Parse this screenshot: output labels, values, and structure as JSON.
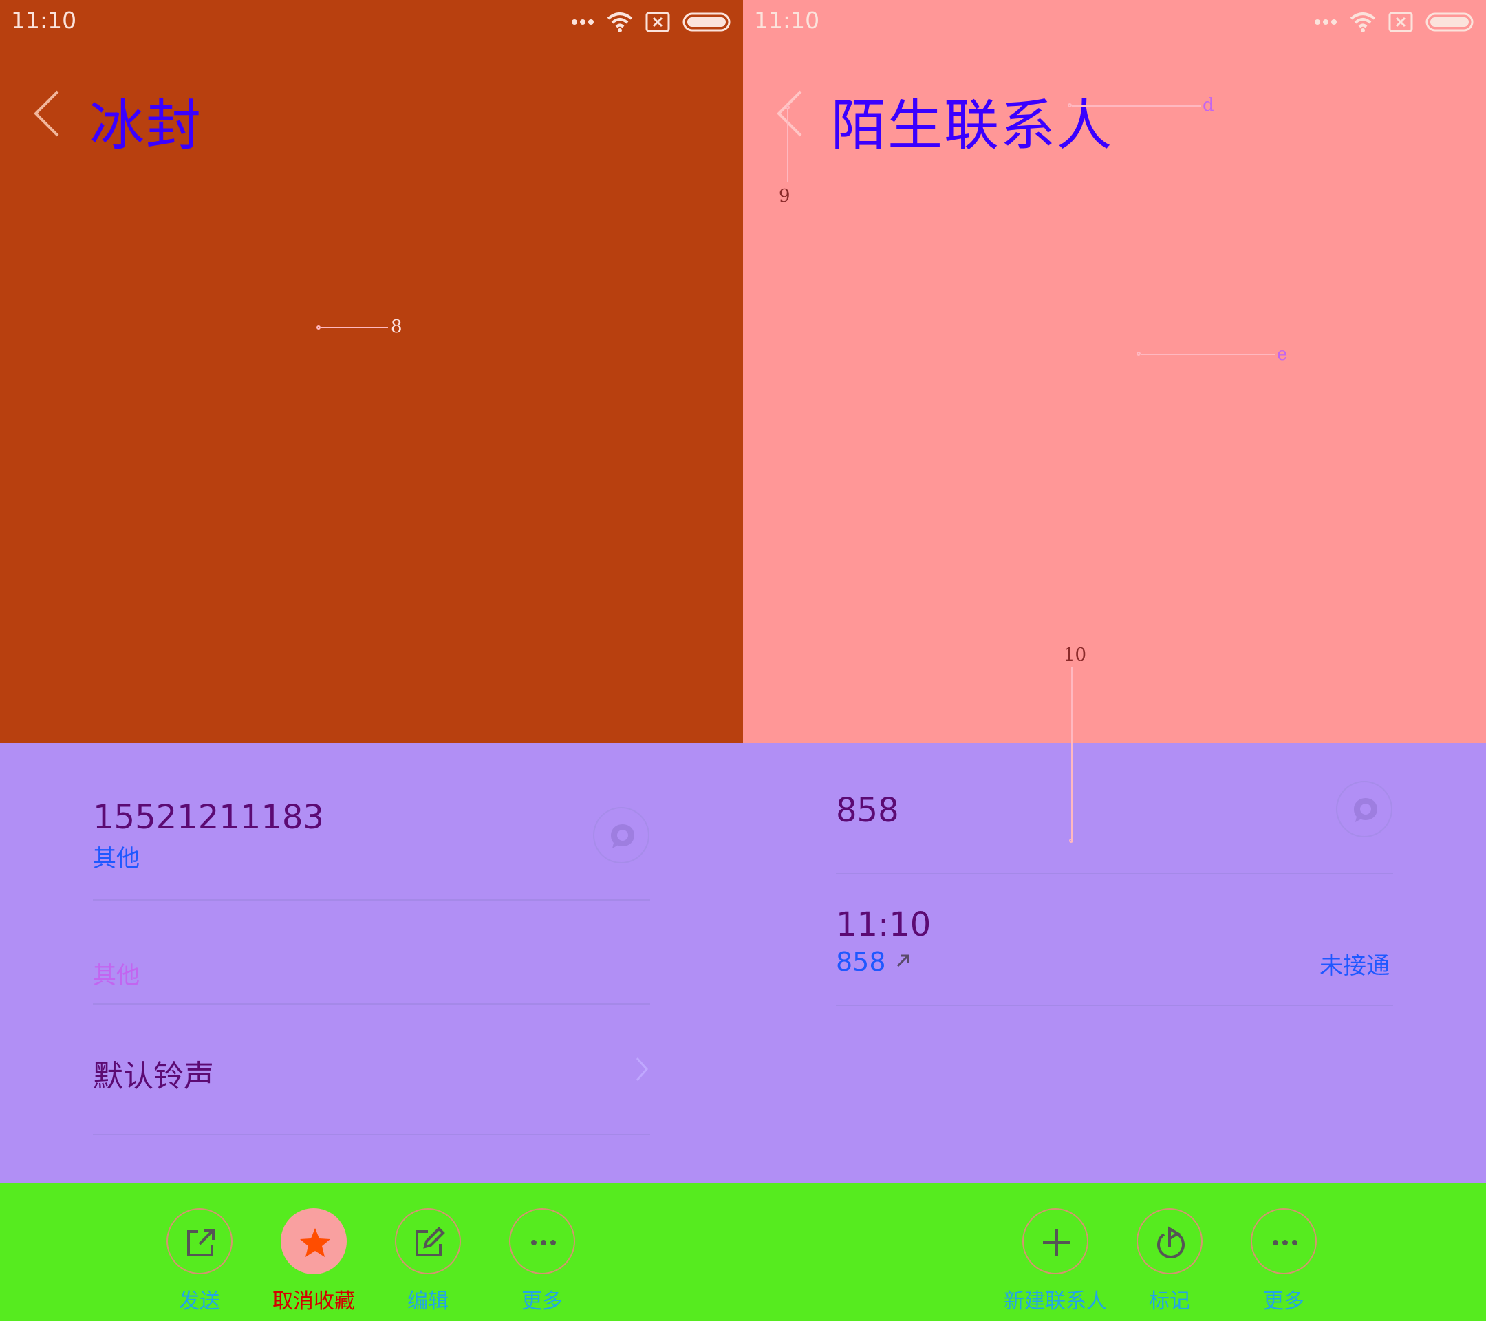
{
  "colors": {
    "left_header_bg": "#b8400f",
    "right_header_bg": "#ff9797",
    "content_bg": "#b18ff5",
    "toolbar_bg": "#56eb1f",
    "title_color": "#3a00ff",
    "primary_text": "#5c0a73",
    "secondary_text": "#1f58ff",
    "faded_label": "#c265f0",
    "toolbar_label": "#22a4e8",
    "favorite_active": "#d40000"
  },
  "left": {
    "status": {
      "time": "11:10"
    },
    "header": {
      "title": "冰封"
    },
    "annotations": {
      "a8": "8"
    },
    "phone": {
      "number": "15521211183",
      "type": "其他"
    },
    "group": {
      "label": "其他"
    },
    "ringtone": {
      "label": "默认铃声"
    },
    "toolbar": {
      "send": "发送",
      "unfavorite": "取消收藏",
      "edit": "编辑",
      "more": "更多"
    }
  },
  "right": {
    "status": {
      "time": "11:10"
    },
    "header": {
      "title": "陌生联系人"
    },
    "annotations": {
      "a9": "9",
      "ad": "d",
      "ae": "e",
      "a10": "10"
    },
    "phone": {
      "number": "858"
    },
    "call_log": {
      "time": "11:10",
      "number": "858",
      "status": "未接通"
    },
    "toolbar": {
      "new_contact": "新建联系人",
      "mark": "标记",
      "more": "更多"
    }
  }
}
